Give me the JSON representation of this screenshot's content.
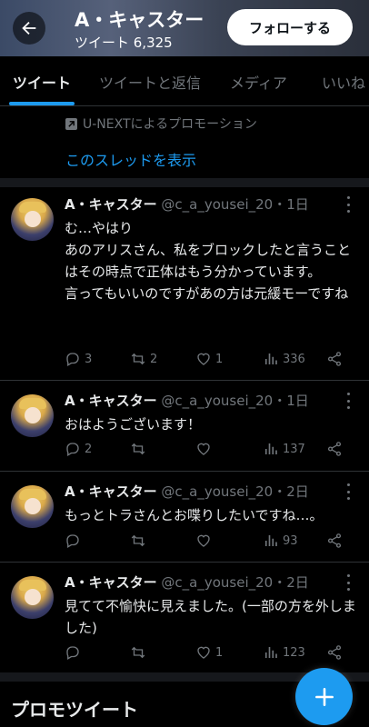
{
  "header": {
    "name": "A・キャスター",
    "tweet_count": "ツイート 6,325",
    "follow_label": "フォローする"
  },
  "tabs": [
    "ツイート",
    "ツイートと返信",
    "メディア",
    "いいね"
  ],
  "promo": {
    "note": "U-NEXTによるプロモーション",
    "thread_link": "このスレッドを表示"
  },
  "tweets": [
    {
      "name": "A・キャスター",
      "meta": "@c_a_yousei_20・1日",
      "text": "む…やはり\nあのアリスさん、私をブロックしたと言うことはその時点で正体はもう分かっています。\n言ってもいいのですがあの方は元緩モーですね",
      "replies": "3",
      "retweets": "2",
      "likes": "1",
      "views": "336"
    },
    {
      "name": "A・キャスター",
      "meta": "@c_a_yousei_20・1日",
      "text": "おはようございます！",
      "replies": "2",
      "retweets": "",
      "likes": "",
      "views": "137"
    },
    {
      "name": "A・キャスター",
      "meta": "@c_a_yousei_20・2日",
      "text": "もっとトラさんとお喋りしたいですね…。",
      "replies": "",
      "retweets": "",
      "likes": "",
      "views": "93"
    },
    {
      "name": "A・キャスター",
      "meta": "@c_a_yousei_20・2日",
      "text": "見てて不愉快に見えました。(一部の方を外しました)",
      "replies": "",
      "retweets": "",
      "likes": "1",
      "views": "123"
    }
  ],
  "promoted_title": "プロモツイート",
  "colors": {
    "accent": "#1d9bf0",
    "background": "#000000",
    "muted": "#71767b"
  }
}
